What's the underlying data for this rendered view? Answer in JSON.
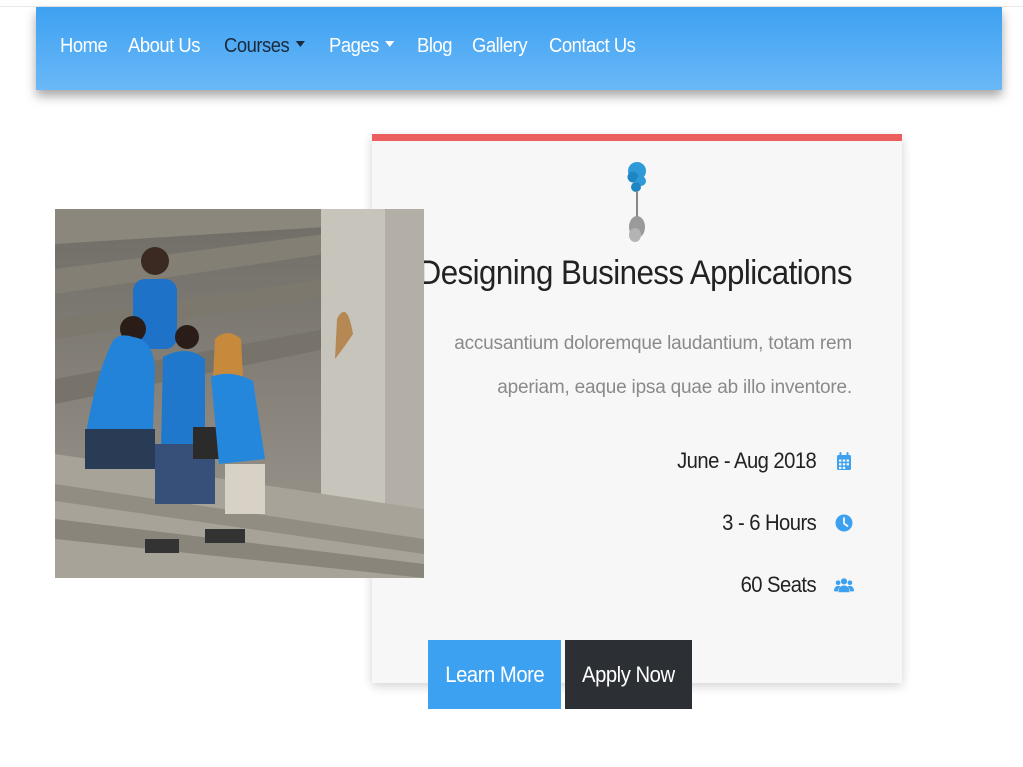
{
  "nav": {
    "items": [
      {
        "label": "Home"
      },
      {
        "label": "About Us"
      },
      {
        "label": "Courses",
        "dropdown": true
      },
      {
        "label": "Pages",
        "dropdown": true
      },
      {
        "label": "Blog"
      },
      {
        "label": "Gallery"
      },
      {
        "label": "Contact Us"
      }
    ]
  },
  "course": {
    "title": "Designing Business Applications",
    "description": "accusantium doloremque laudantium, totam rem aperiam, eaque ipsa quae ab illo inventore.",
    "date": "June - Aug 2018",
    "date_icon": "calendar-icon",
    "duration": "3 - 6 Hours",
    "duration_icon": "clock-icon",
    "seats": "60 Seats",
    "seats_icon": "users-icon",
    "image_icon": "pin-icon"
  },
  "buttons": {
    "learn_more": "Learn More",
    "apply_now": "Apply Now"
  },
  "colors": {
    "accent": "#3da1f1",
    "card_top_border": "#ec5e5e",
    "dark_button": "#2c3035"
  }
}
